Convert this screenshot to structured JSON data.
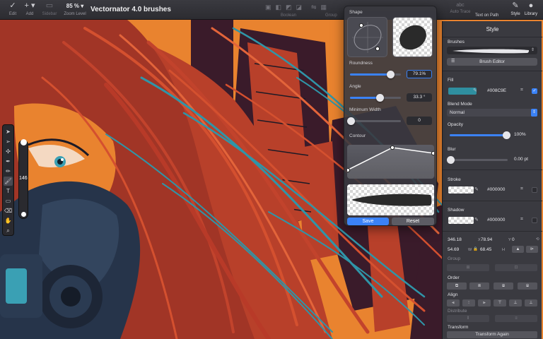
{
  "toolbar": {
    "edit_label": "Edit",
    "add_label": "Add",
    "sidebar_label": "Sidebar",
    "zoom_value": "85 %",
    "zoom_label": "Zoom Level",
    "doc_title": "Vectornator 4.0 brushes",
    "boolean_label": "Boolean",
    "group_label": "Group",
    "autotrace_label": "Auto Trace",
    "textonpath_label": "Text on Path",
    "style_label": "Style",
    "library_label": "Library",
    "icons": {
      "edit": "check-icon",
      "add": "plus-icon",
      "sidebar": "sidebar-icon",
      "boolean": "boolean-icon",
      "group": "group-icon",
      "autotrace": "abc-icon",
      "style": "brush-icon",
      "library": "library-icon"
    }
  },
  "tools": {
    "items": [
      "selection-arrow",
      "direct-selection",
      "node",
      "pen",
      "pencil",
      "brush",
      "text",
      "rectangle",
      "eraser",
      "hand",
      "zoom"
    ],
    "brush_size": "146"
  },
  "brush_editor": {
    "shape_label": "Shape",
    "roundness_label": "Roundness",
    "roundness_value": "79.1%",
    "roundness": 0.79,
    "angle_label": "Angle",
    "angle_value": "33.3 °",
    "angle": 0.58,
    "min_width_label": "Minimum Width",
    "min_width_value": "0",
    "min_width": 0.0,
    "contour_label": "Contour",
    "save_label": "Save",
    "reset_label": "Reset",
    "accent": "#3b82f6"
  },
  "style_panel": {
    "title": "Style",
    "brushes_label": "Brushes",
    "brush_editor_label": "Brush Editor",
    "fill_label": "Fill",
    "fill_hex": "#008C9E",
    "fill_color": "#2f8fa0",
    "blend_label": "Blend Mode",
    "blend_value": "Normal",
    "opacity_label": "Opacity",
    "opacity_value": "100%",
    "opacity": 1.0,
    "blur_label": "Blur",
    "blur_value": "0.00 pt",
    "blur": 0.0,
    "stroke_label": "Stroke",
    "stroke_hex": "#000000",
    "shadow_label": "Shadow",
    "shadow_hex": "#000000",
    "x_value": "346.18",
    "x_label": "X",
    "y_value": "78.94",
    "y_label": "Y",
    "rot_value": "0",
    "w_value": "54.69",
    "w_label": "W",
    "h_value": "68.45",
    "h_label": "H",
    "group_label": "Group",
    "order_label": "Order",
    "align_label": "Align",
    "distribute_label": "Distribute",
    "transform_label": "Transform",
    "transform_again_label": "Transform Again"
  }
}
